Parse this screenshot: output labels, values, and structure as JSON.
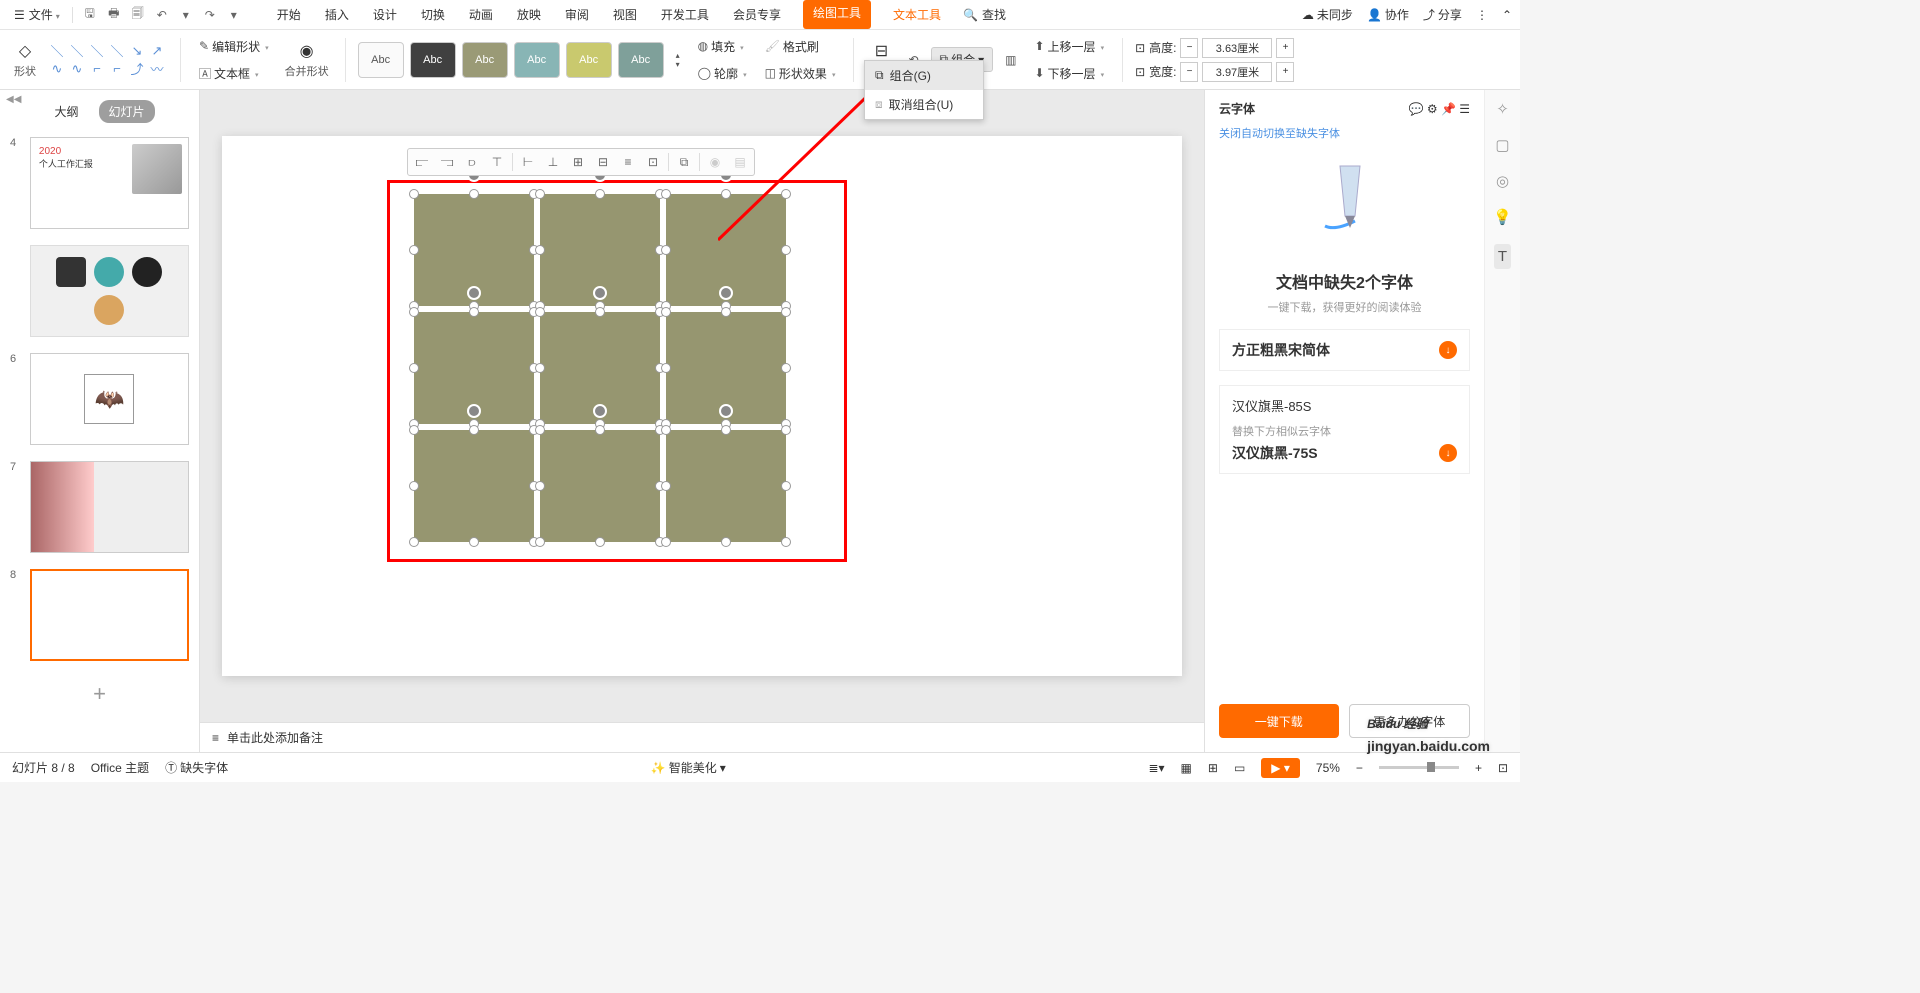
{
  "titlebar": {
    "file": "文件",
    "tabs": [
      "开始",
      "插入",
      "设计",
      "切换",
      "动画",
      "放映",
      "审阅",
      "视图",
      "开发工具",
      "会员专享"
    ],
    "drawing_tool": "绘图工具",
    "text_tool": "文本工具",
    "search": "查找",
    "unsynced": "未同步",
    "collab": "协作",
    "share": "分享"
  },
  "ribbon": {
    "shape": "形状",
    "edit_shape": "编辑形状",
    "textbox": "文本框",
    "merge_shape": "合并形状",
    "style_label": "Abc",
    "fill": "填充",
    "outline": "轮廓",
    "format_painter": "格式刷",
    "shape_effects": "形状效果",
    "align": "对齐",
    "group": "组合",
    "group_g": "组合(G)",
    "ungroup": "取消组合(U)",
    "bring_forward": "上移一层",
    "send_backward": "下移一层",
    "rotate": "旋转",
    "height_label": "高度:",
    "width_label": "宽度:",
    "height_val": "3.63厘米",
    "width_val": "3.97厘米"
  },
  "sidebar": {
    "outline": "大纲",
    "slides": "幻灯片",
    "thumbs": [
      {
        "num": "4",
        "title": "2020",
        "sub": "个人工作汇报"
      },
      {
        "num": ""
      },
      {
        "num": "6"
      },
      {
        "num": "7"
      },
      {
        "num": "8"
      }
    ]
  },
  "float_icons": [
    "⫷",
    "⫸",
    "⫶",
    "⊤",
    "⊢",
    "⊥",
    "⊣",
    "⊞",
    "⊟",
    "⊡",
    "回",
    "⧉",
    "◉",
    "▤"
  ],
  "notes_placeholder": "单击此处添加备注",
  "right_panel": {
    "title": "云字体",
    "link": "关闭自动切换至缺失字体",
    "missing_title": "文档中缺失2个字体",
    "missing_sub": "一键下载，获得更好的阅读体验",
    "font1": "方正粗黑宋简体",
    "font2": "汉仪旗黑-85S",
    "font2_hint": "替换下方相似云字体",
    "font2_alt": "汉仪旗黑-75S",
    "btn_download": "一键下载",
    "btn_more": "更多办公字体"
  },
  "statusbar": {
    "slide_info": "幻灯片 8 / 8",
    "theme": "Office 主题",
    "missing_fonts": "缺失字体",
    "beautify": "智能美化",
    "zoom": "75%"
  },
  "watermark": {
    "main": "Baidu 经验",
    "sub": "jingyan.baidu.com"
  }
}
